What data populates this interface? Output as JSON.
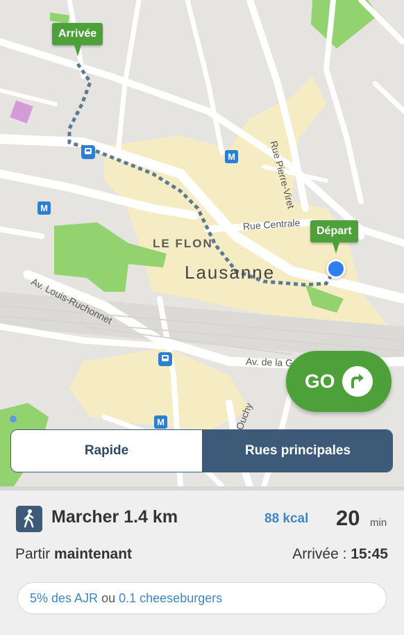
{
  "map": {
    "pin_arrivee": "Arrivée",
    "pin_depart": "Départ",
    "labels": {
      "le_flon": "LE FLON",
      "city": "Lausanne",
      "rue_centrale": "Rue Centrale",
      "rue_pierre_viret": "Rue Pierre-Viret",
      "av_louis_ruchonnet": "Av. Louis-Ruchonnet",
      "av_de_la_gare": "Av. de la G",
      "ouchy": "Ouchy"
    },
    "metro_label": "M",
    "colors": {
      "route": "#5b7a92",
      "park": "#93d36f",
      "pin": "#4ea13a",
      "transit": "#2f7fd0"
    }
  },
  "go_button": {
    "label": "GO",
    "icon": "turn-right-arrow-icon"
  },
  "route_options": {
    "rapide": "Rapide",
    "rues_principales": "Rues principales",
    "selected": "Rues principales"
  },
  "summary": {
    "mode_icon": "walking-person-icon",
    "mode": "Marcher 1.4 km",
    "kcal": "88 kcal",
    "duration_value": "20",
    "duration_unit": "min",
    "depart_prefix": "Partir",
    "depart_value": "maintenant",
    "arrival_prefix": "Arrivée :",
    "arrival_time": "15:45"
  },
  "nutrition": {
    "ajr": "5% des AJR",
    "connector": "ou",
    "cheeseburgers": "0.1 cheeseburgers"
  },
  "accent_colors": {
    "dark_blue": "#3d5a78",
    "link_blue": "#3e86c4",
    "green": "#4ea13a"
  }
}
